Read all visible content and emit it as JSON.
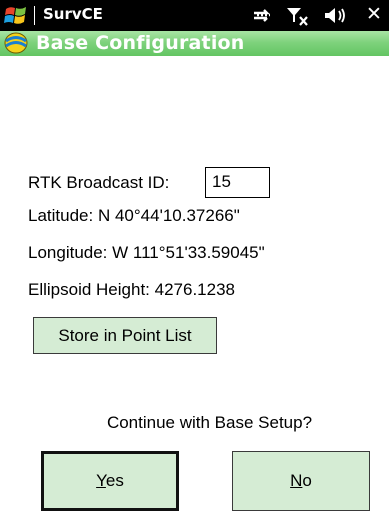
{
  "statusbar": {
    "app_name": "SurvCE",
    "icons": [
      "windows-start-icon",
      "connectivity-icon",
      "filter-icon",
      "volume-icon",
      "close-icon"
    ],
    "close_glyph": "✕"
  },
  "titlebar": {
    "title": "Base Configuration",
    "icon": "base-configuration-icon"
  },
  "fields": {
    "broadcast_id_label": "RTK Broadcast ID:",
    "broadcast_id_value": "15",
    "latitude_label": "Latitude:",
    "latitude_value": "N 40°44'10.37266\"",
    "longitude_label": "Longitude:",
    "longitude_value": "W 111°51'33.59045\"",
    "ellipsoid_label": "Ellipsoid Height:",
    "ellipsoid_value": "4276.1238"
  },
  "buttons": {
    "store": "Store in Point List",
    "yes_mnemonic": "Y",
    "yes_rest": "es",
    "no_mnemonic": "N",
    "no_rest": "o"
  },
  "prompt": "Continue with Base Setup?",
  "colors": {
    "statusbar_bg": "#000000",
    "titlebar_green": "#7fd27d",
    "button_fill": "#d5ecd4"
  }
}
